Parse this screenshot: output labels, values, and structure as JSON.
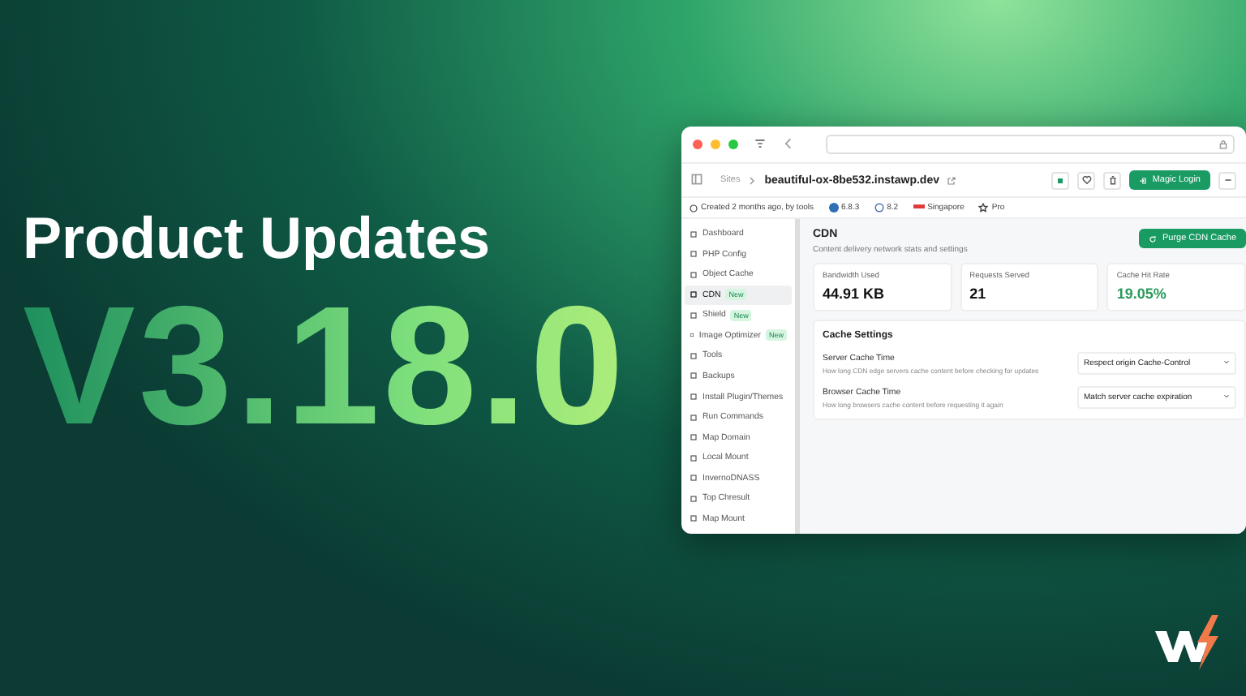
{
  "headline": "Product Updates",
  "version": "V3.18.0",
  "browser": {
    "breadcrumb": {
      "parent": "Sites",
      "site": "beautiful-ox-8be532.instawp.dev"
    },
    "magic_login": "Magic Login",
    "meta": [
      {
        "kind": "text",
        "label": "Created 2 months ago, by tools"
      },
      {
        "kind": "wp",
        "label": "6.8.3"
      },
      {
        "kind": "php",
        "label": "8.2"
      },
      {
        "kind": "flag",
        "label": "Singapore"
      },
      {
        "kind": "plan",
        "label": "Pro"
      }
    ],
    "sidebar": [
      {
        "label": "Dashboard",
        "selected": false
      },
      {
        "label": "PHP Config",
        "selected": false
      },
      {
        "label": "Object Cache",
        "selected": false
      },
      {
        "label": "CDN",
        "selected": true,
        "badge": "New"
      },
      {
        "label": "Shield",
        "selected": false,
        "badge": "New"
      },
      {
        "label": "Image Optimizer",
        "selected": false,
        "badge": "New"
      },
      {
        "label": "Tools",
        "selected": false
      },
      {
        "label": "Backups",
        "selected": false
      },
      {
        "label": "Install Plugin/Themes",
        "selected": false
      },
      {
        "label": "Run Commands",
        "selected": false
      },
      {
        "label": "Map Domain",
        "selected": false
      },
      {
        "label": "Local Mount",
        "selected": false
      },
      {
        "label": "InvernoDNASS",
        "selected": false
      },
      {
        "label": "Top Chresult",
        "selected": false
      },
      {
        "label": "Map Mount",
        "selected": false
      }
    ],
    "page": {
      "title": "CDN",
      "subtitle": "Content delivery network stats and settings",
      "action": "Purge CDN Cache",
      "stats": [
        {
          "label": "Bandwidth Used",
          "value": "44.91 KB",
          "kind": "plain"
        },
        {
          "label": "Requests Served",
          "value": "21",
          "kind": "plain"
        },
        {
          "label": "Cache Hit Rate",
          "value": "19.05%",
          "kind": "positive"
        }
      ],
      "settings": {
        "title": "Cache Settings",
        "rows": [
          {
            "label": "Server Cache Time",
            "description": "How long CDN edge servers cache content before checking for updates",
            "value": "Respect origin Cache-Control"
          },
          {
            "label": "Browser Cache Time",
            "description": "How long browsers cache content before requesting it again",
            "value": "Match server cache expiration"
          }
        ]
      }
    }
  }
}
